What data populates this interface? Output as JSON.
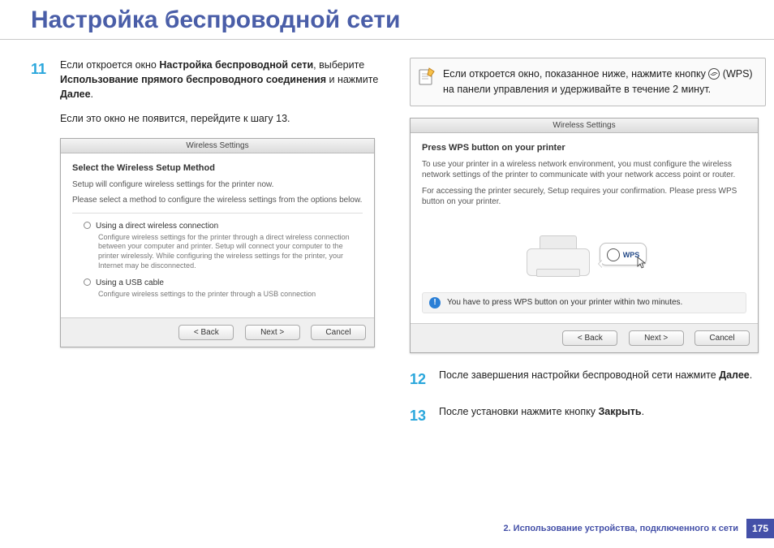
{
  "title": "Настройка беспроводной сети",
  "left": {
    "step11": {
      "num": "11",
      "t1": "Если откроется окно ",
      "b1": "Настройка беспроводной сети",
      "t2": ", выберите ",
      "b2": "Использование прямого беспроводного соединения",
      "t3": " и нажмите ",
      "b3": "Далее",
      "t4": ".",
      "sub": "Если это окно не появится, перейдите к шагу 13."
    },
    "dialog": {
      "title": "Wireless Settings",
      "heading": "Select the Wireless Setup Method",
      "line1": "Setup will configure wireless settings for the printer now.",
      "line2": "Please select a method to configure the wireless settings from the options below.",
      "opt1": {
        "label": "Using a direct wireless connection",
        "desc": "Configure wireless settings for the printer through a direct wireless connection between your computer and printer. Setup will connect your computer to the printer wirelessly.\nWhile configuring the wireless settings for the printer, your Internet may be disconnected."
      },
      "opt2": {
        "label": "Using a USB cable",
        "desc": "Configure wireless settings to the printer through a USB connection"
      },
      "back": "< Back",
      "next": "Next >",
      "cancel": "Cancel"
    }
  },
  "right": {
    "note": {
      "t1": "Если откроется окно, показанное ниже, нажмите кнопку ",
      "wps": " (WPS) на панели управления и удерживайте в течение 2 минут."
    },
    "dialog": {
      "title": "Wireless Settings",
      "heading": "Press WPS button on your printer",
      "line1": "To use your printer in a wireless network environment, you must configure the wireless network settings of the printer to communicate with your network access point or router.",
      "line2": "For accessing the printer securely, Setup requires your confirmation. Please press WPS button on your printer.",
      "wps_label": "WPS",
      "alert": "You have to press WPS button on your printer within two minutes.",
      "back": "< Back",
      "next": "Next >",
      "cancel": "Cancel"
    },
    "step12": {
      "num": "12",
      "t1": "После завершения настройки беспроводной сети нажмите ",
      "b1": "Далее",
      "t2": "."
    },
    "step13": {
      "num": "13",
      "t1": "После установки нажмите кнопку ",
      "b1": "Закрыть",
      "t2": "."
    }
  },
  "footer": {
    "text": "2.  Использование устройства, подключенного к сети",
    "page": "175"
  }
}
